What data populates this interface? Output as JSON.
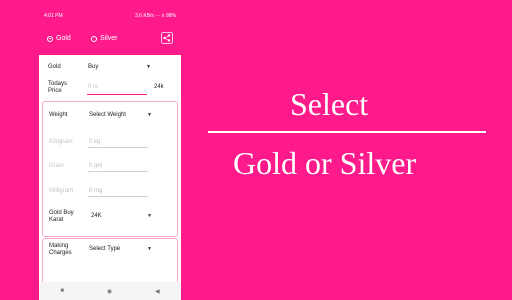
{
  "status": {
    "time": "4:01 PM",
    "right": "3.6 KB/s ··· ≡ 98%"
  },
  "appbar": {
    "gold_label": "Gold",
    "silver_label": "Silver"
  },
  "form": {
    "metal_label": "Gold",
    "metal_value": "Buy",
    "price_label_line1": "Todays",
    "price_label_line2": "Price",
    "price_placeholder": "0 rs",
    "price_karat": "24k",
    "weight_label": "Weight",
    "weight_value": "Select Weight",
    "kilogram_label": "Kilogram",
    "kilogram_placeholder": "0 kg",
    "gram_label": "Gram",
    "gram_placeholder": "0 gm",
    "milligram_label": "Milligram",
    "milligram_placeholder": "0 mg",
    "karat_label_line1": "Gold Buy",
    "karat_label_line2": "Karat",
    "karat_value": "24K",
    "making_label_line1": "Making",
    "making_label_line2": "Charges",
    "making_value": "Select Type"
  },
  "headline": {
    "line1": "Select",
    "line2": "Gold or Silver"
  },
  "colors": {
    "background": "#ff1a8c",
    "card_border": "#f7a8cf",
    "accent": "#ff1a8c"
  },
  "icons": {
    "share": "share-icon",
    "dropdown": "caret-down-icon"
  }
}
